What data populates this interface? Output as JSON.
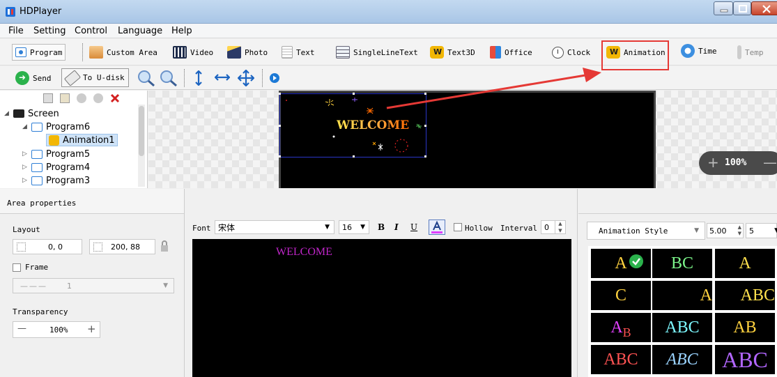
{
  "window": {
    "title": "HDPlayer"
  },
  "menu": [
    "File",
    "Setting",
    "Control",
    "Language",
    "Help"
  ],
  "toolbar1": {
    "program": "Program",
    "custom_area": "Custom Area",
    "video": "Video",
    "photo": "Photo",
    "text": "Text",
    "single_line_text": "SingleLineText",
    "text3d": "Text3D",
    "office": "Office",
    "clock": "Clock",
    "animation": "Animation",
    "time": "Time",
    "temp": "Temp"
  },
  "toolbar2": {
    "send": "Send",
    "to_udisk": "To U-disk"
  },
  "tree": {
    "root": "Screen",
    "items": [
      {
        "label": "Program6",
        "expanded": true
      },
      {
        "label": "Animation1",
        "selected": true
      },
      {
        "label": "Program5"
      },
      {
        "label": "Program4"
      },
      {
        "label": "Program3"
      }
    ]
  },
  "preview": {
    "text": "WELCOME",
    "zoom": "100%",
    "zoom_plus": "+",
    "zoom_minus": "—"
  },
  "properties": {
    "header": "Area properties",
    "layout_label": "Layout",
    "position": "0, 0",
    "size": "200, 88",
    "frame_label": "Frame",
    "frame_value": "1",
    "transparency_label": "Transparency",
    "transparency": "100%",
    "minus": "—",
    "plus": "+"
  },
  "editor": {
    "font_label": "Font",
    "font_value": "宋体",
    "size_value": "16",
    "bold": "B",
    "italic": "I",
    "underline": "U",
    "hollow_label": "Hollow",
    "interval_label": "Interval",
    "interval_value": "0",
    "content": "WELCOME"
  },
  "animation_style": {
    "label": "Animation Style",
    "speed": "5.00",
    "count": "5",
    "samples": [
      "A",
      "BC",
      "A",
      "C",
      "A",
      "ABC",
      "A",
      "B",
      "ABC",
      "AB",
      "ABC",
      "ABC",
      "ABC"
    ]
  },
  "colors": {
    "accent_red": "#e53935",
    "selection_blue": "#2a36c8",
    "editor_text": "#c026c9"
  }
}
